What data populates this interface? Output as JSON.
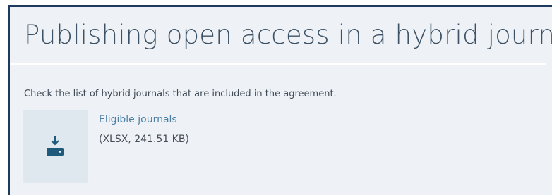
{
  "section": {
    "title": "Publishing open access in a hybrid journal",
    "intro": "Check the list of hybrid journals that are included in the agreement."
  },
  "download": {
    "link_label": "Eligible journals",
    "file_info": "(XLSX, 241.51 KB)",
    "icon": "download-icon"
  },
  "colors": {
    "panel_background": "#eef2f6",
    "panel_border": "#1e3a5f",
    "link": "#4a7fa3",
    "icon": "#1f5a7d",
    "tile_background": "#dfe8ef"
  }
}
